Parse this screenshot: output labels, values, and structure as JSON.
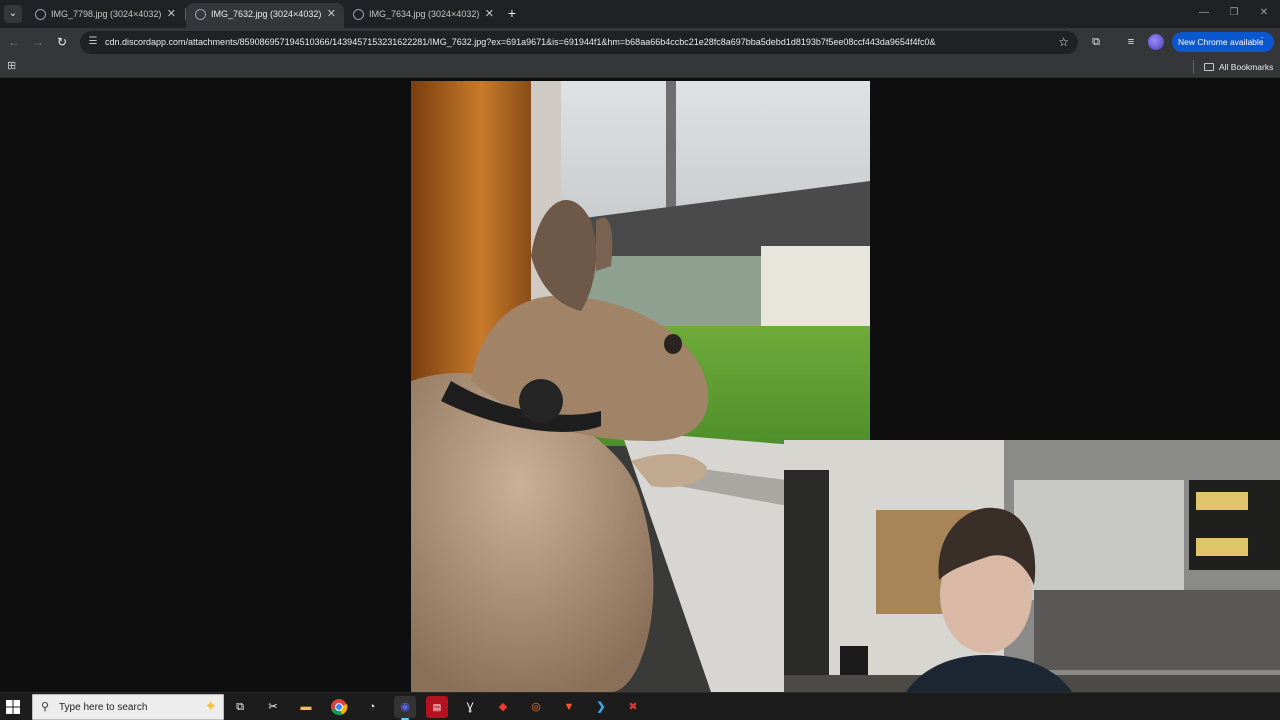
{
  "browser": {
    "tabs": [
      {
        "title": "IMG_7798.jpg (3024×4032)",
        "active": false
      },
      {
        "title": "IMG_7632.jpg (3024×4032)",
        "active": true
      },
      {
        "title": "IMG_7634.jpg (3024×4032)",
        "active": false
      }
    ],
    "tab_close_glyph": "✕",
    "new_tab_glyph": "+",
    "window_controls": {
      "minimize": "—",
      "restore": "❐",
      "close": "✕"
    },
    "url": "cdn.discordapp.com/attachments/859086957194510366/1439457153231622281/IMG_7632.jpg?ex=691a9671&is=691944f1&hm=b68aa66b4ccbc21e28fc8a697bba5debd1d8193b7f5ee08ccf443da9654f4fc0&",
    "update_button": "New Chrome available",
    "all_bookmarks": "All Bookmarks",
    "icons": {
      "back": "back-arrow-icon",
      "forward": "forward-arrow-icon",
      "reload": "reload-icon",
      "star": "star-icon",
      "extensions": "puzzle-icon",
      "media": "media-controls-icon",
      "apps": "apps-grid-icon"
    }
  },
  "viewer": {
    "background": "#0e0e0e",
    "image_description_alt": "IMG_7632.jpg"
  },
  "taskbar": {
    "search_placeholder": "Type here to search",
    "apps": [
      {
        "name": "task-view",
        "glyph": "⧉"
      },
      {
        "name": "capcut",
        "glyph": "✂"
      },
      {
        "name": "file-explorer",
        "glyph": "▬"
      },
      {
        "name": "chrome",
        "glyph": ""
      },
      {
        "name": "speed-tool",
        "glyph": "◔"
      },
      {
        "name": "discord",
        "glyph": "◉"
      },
      {
        "name": "voice-app",
        "glyph": "▤"
      },
      {
        "name": "script-app",
        "glyph": "Ɣ"
      },
      {
        "name": "red-app",
        "glyph": "◆"
      },
      {
        "name": "blender",
        "glyph": "◎"
      },
      {
        "name": "brave",
        "glyph": "▼"
      },
      {
        "name": "vscode",
        "glyph": "❯"
      },
      {
        "name": "capture-app",
        "glyph": "✖"
      }
    ]
  },
  "colors": {
    "tabstrip": "#202124",
    "toolbar": "#35363a",
    "accent": "#0b57d0",
    "taskbar": "#1c1c1c"
  }
}
